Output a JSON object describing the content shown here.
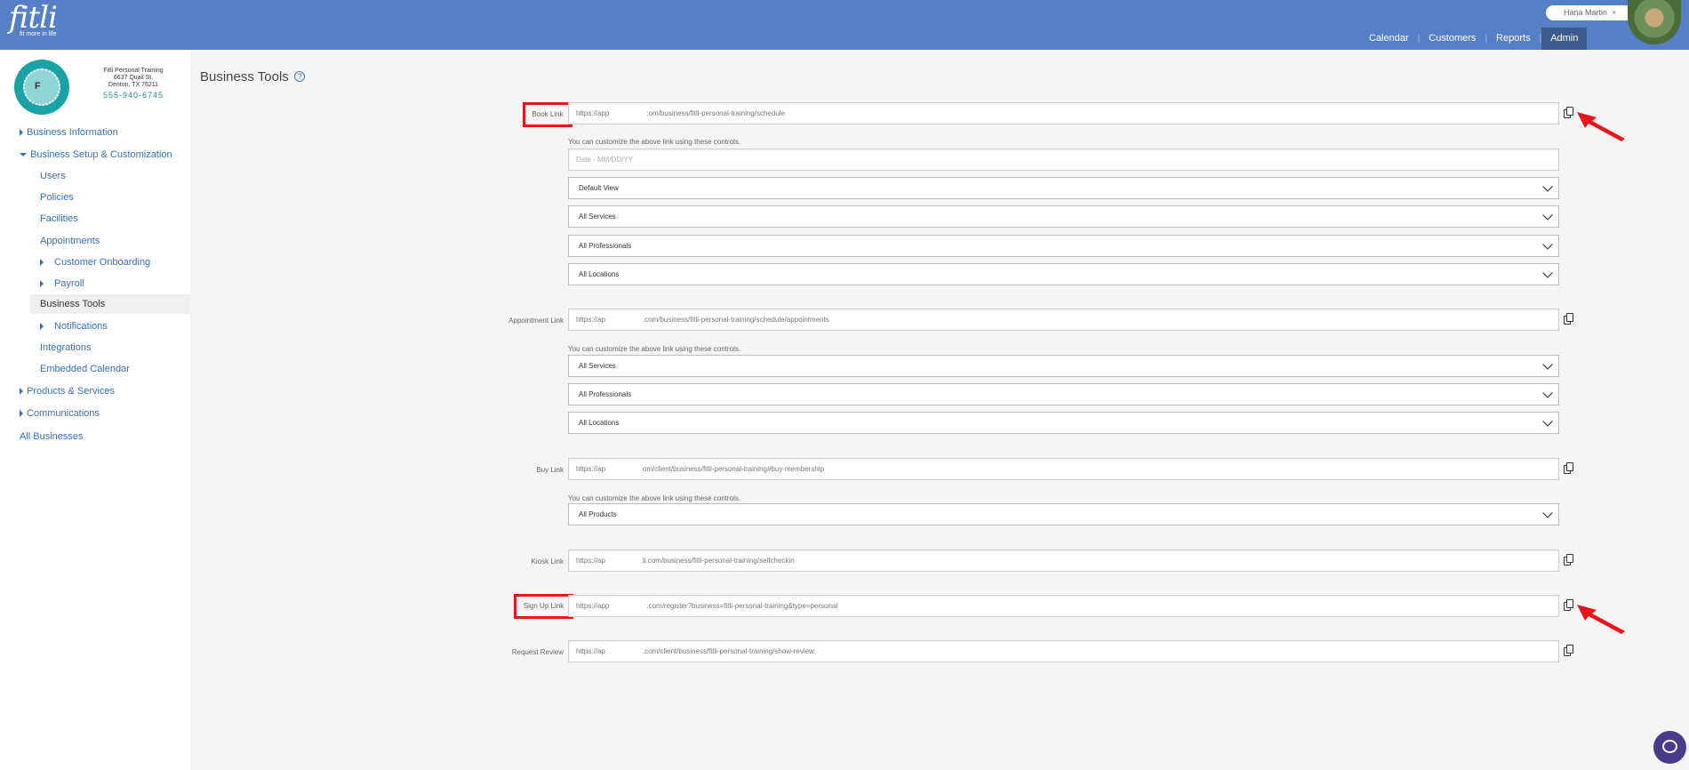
{
  "header": {
    "logo": "fitli",
    "tagline": "fit more in life",
    "user_name": "Hana Martin",
    "user_close": "×",
    "nav": [
      {
        "label": "Calendar"
      },
      {
        "label": "Customers"
      },
      {
        "label": "Reports"
      },
      {
        "label": "Admin",
        "active": true
      }
    ]
  },
  "business": {
    "logo_text": "F",
    "name": "Fitli Personal Training",
    "address1": "6637 Quail St.",
    "address2": "Denton, TX 76211",
    "phone": "555-940-6745"
  },
  "sidebar": {
    "items": [
      {
        "label": "Business Information"
      },
      {
        "label": "Business Setup & Customization"
      },
      {
        "label": "Users"
      },
      {
        "label": "Policies"
      },
      {
        "label": "Facilities"
      },
      {
        "label": "Appointments"
      },
      {
        "label": "Customer Onboarding"
      },
      {
        "label": "Payroll"
      },
      {
        "label": "Business Tools",
        "active": true
      },
      {
        "label": "Notifications"
      },
      {
        "label": "Integrations"
      },
      {
        "label": "Embedded Calendar"
      },
      {
        "label": "Products & Services"
      },
      {
        "label": "Communications"
      },
      {
        "label": "All Businesses"
      }
    ]
  },
  "page": {
    "title": "Business Tools",
    "help": "?",
    "hint": "You can customize the above link using these controls.",
    "book": {
      "label": "Book Link",
      "url_start": "https://app",
      "url_end": ":om/business/fitli-personal-training/schedule",
      "date_placeholder": "Date - MM/DD/YY",
      "selects": [
        "Default View",
        "All Services",
        "All Professionals",
        "All Locations"
      ]
    },
    "appointment": {
      "label": "Appointment Link",
      "url_start": "https://ap",
      "url_end": ".com/business/fitli-personal-training/schedule/appointments",
      "selects": [
        "All Services",
        "All Professionals",
        "All Locations"
      ]
    },
    "buy": {
      "label": "Buy Link",
      "url_start": "https://ap",
      "url_end": "om/client/business/fitli-personal-training#buy-membership",
      "selects": [
        "All Products"
      ]
    },
    "kiosk": {
      "label": "Kiosk Link",
      "url_start": "https://ap",
      "url_end": "li.com/business/fitli-personal-training/selfcheckin"
    },
    "signup": {
      "label": "Sign Up Link",
      "url_start": "https://app",
      "url_end": ".com/register?business=fitli-personal-training&type=personal"
    },
    "review": {
      "label": "Request Review",
      "url_start": "https://ap",
      "url_end": ".com/client/business/fitli-personal-training/show-review"
    }
  },
  "colors": {
    "header": "#5580c8",
    "annotation": "#e8151a",
    "link": "#3a6fb0"
  }
}
